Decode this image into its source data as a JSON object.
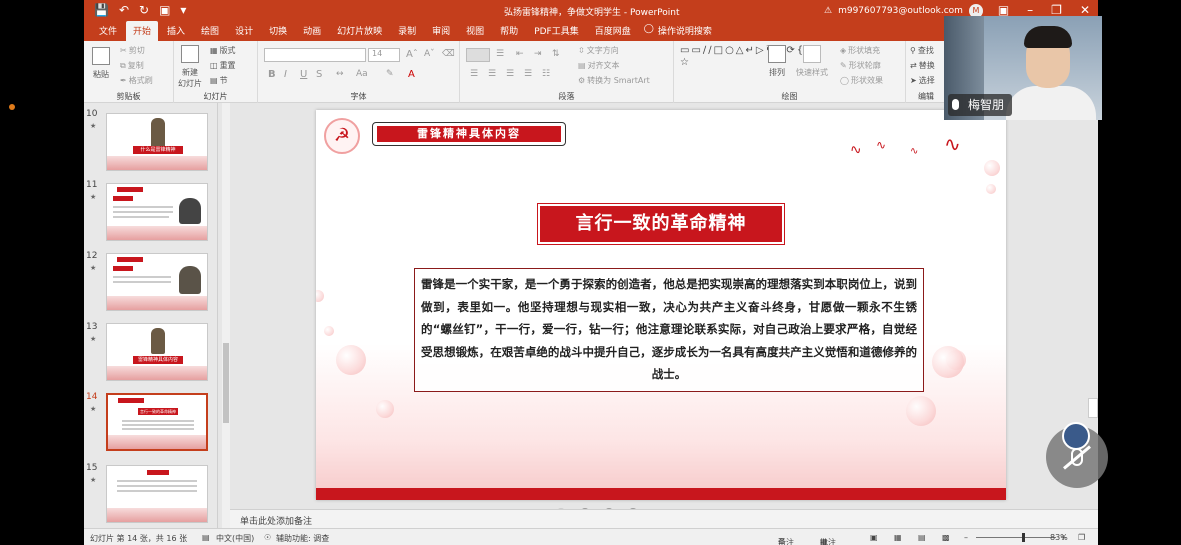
{
  "titlebar": {
    "title": "弘扬雷锋精神，争做文明学生 - PowerPoint",
    "account": "m997607793@outlook.com",
    "avatar_letter": "M"
  },
  "tabs": [
    "文件",
    "开始",
    "插入",
    "绘图",
    "设计",
    "切换",
    "动画",
    "幻灯片放映",
    "录制",
    "审阅",
    "视图",
    "帮助",
    "PDF工具集",
    "百度网盘"
  ],
  "active_tab": "开始",
  "tell_me": "操作说明搜索",
  "ribbon": {
    "clipboard": {
      "paste": "粘贴",
      "cut": "剪切",
      "copy": "复制",
      "format_painter": "格式刷",
      "label": "剪贴板"
    },
    "slides": {
      "new_slide": "新建\n幻灯片",
      "layout": "版式",
      "reset": "重置",
      "section": "节",
      "label": "幻灯片"
    },
    "font": {
      "size": "14",
      "bold": "B",
      "italic": "I",
      "underline": "U",
      "strike": "S",
      "label": "字体"
    },
    "paragraph": {
      "text_direction": "文字方向",
      "align_text": "对齐文本",
      "smartart": "转换为 SmartArt",
      "label": "段落"
    },
    "drawing": {
      "arrange": "排列",
      "quick_styles": "快速样式",
      "fill": "形状填充",
      "outline": "形状轮廓",
      "effects": "形状效果",
      "label": "绘图"
    },
    "editing": {
      "find": "查找",
      "replace": "替换",
      "select": "选择",
      "label": "编辑"
    }
  },
  "thumbnails": [
    {
      "num": "10",
      "caption": "什么是雷锋精神"
    },
    {
      "num": "11",
      "caption": ""
    },
    {
      "num": "12",
      "caption": ""
    },
    {
      "num": "13",
      "caption": "雷锋精神具体内容"
    },
    {
      "num": "14",
      "caption": "言行一致的革命精神"
    },
    {
      "num": "15",
      "caption": ""
    }
  ],
  "selected_thumbnail": "14",
  "slide": {
    "header": "雷锋精神具体内容",
    "title": "言行一致的革命精神",
    "body": "雷锋是一个实干家，是一个勇于探索的创造者，他总是把实现崇高的理想落实到本职岗位上，说到做到，表里如一。他坚持理想与现实相一致，决心为共产主义奋斗终身，甘愿做一颗永不生锈的“螺丝钉”，干一行，爱一行，钻一行；他注意理论联系实际，对自己政治上要求严格，自觉经受思想锻炼，在艰苦卓绝的战斗中提升自己，逐步成长为一名具有高度共产主义觉悟和道德修养的战士。"
  },
  "notes_placeholder": "单击此处添加备注",
  "status": {
    "slide_info": "幻灯片 第 14 张，共 16 张",
    "language": "中文(中国)",
    "accessibility": "辅助功能: 调查",
    "notes": "备注",
    "comments": "批注",
    "zoom": "83%"
  },
  "video": {
    "name": "梅智朋"
  },
  "colors": {
    "accent": "#c43e1c",
    "slide_red": "#c8161d"
  },
  "pager": {
    "count": 4,
    "active": 0
  }
}
